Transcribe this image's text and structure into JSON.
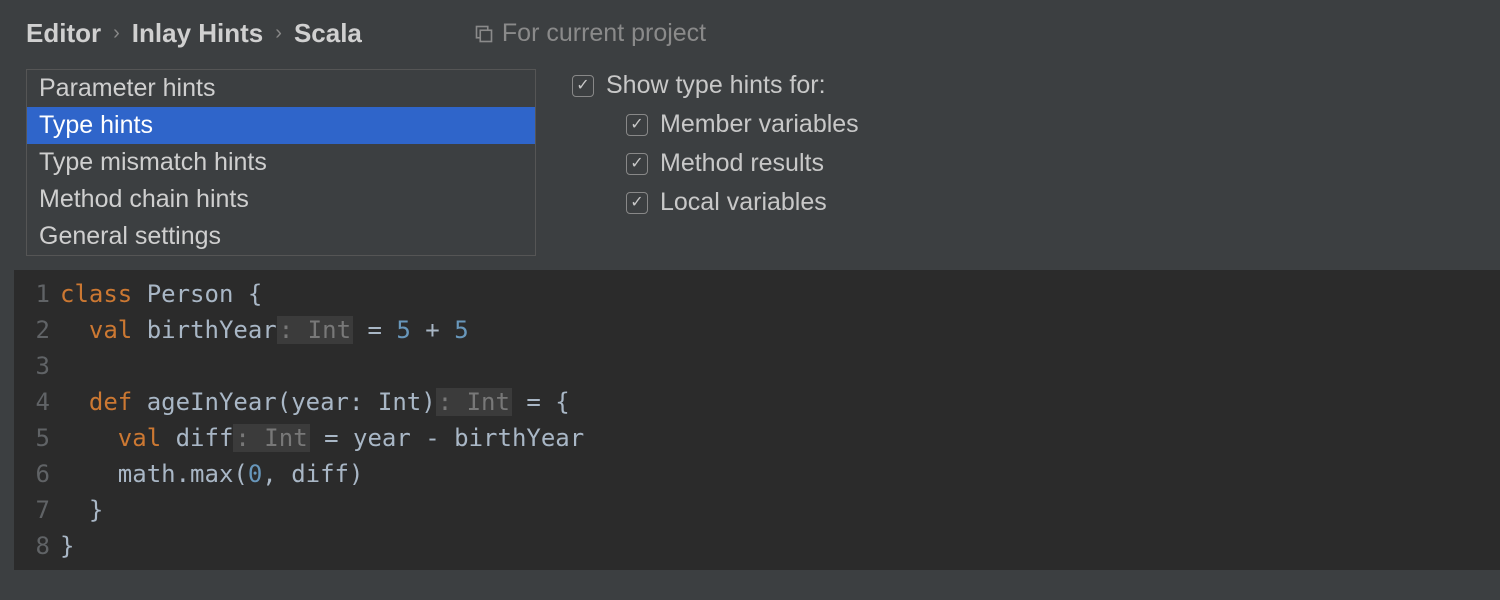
{
  "breadcrumb": {
    "items": [
      "Editor",
      "Inlay Hints",
      "Scala"
    ],
    "scope_label": "For current project"
  },
  "list": {
    "items": [
      "Parameter hints",
      "Type hints",
      "Type mismatch hints",
      "Method chain hints",
      "General settings"
    ],
    "selected_index": 1
  },
  "options": {
    "header": "Show type hints for:",
    "items": [
      "Member variables",
      "Method results",
      "Local variables"
    ]
  },
  "code": {
    "lines": [
      {
        "n": "1",
        "tokens": [
          [
            "kw",
            "class"
          ],
          [
            "id",
            " Person {"
          ]
        ]
      },
      {
        "n": "2",
        "tokens": [
          [
            "id",
            "  "
          ],
          [
            "kw",
            "val"
          ],
          [
            "id",
            " birthYear"
          ],
          [
            "hint",
            ": Int"
          ],
          [
            "id",
            " = "
          ],
          [
            "num",
            "5"
          ],
          [
            "id",
            " + "
          ],
          [
            "num",
            "5"
          ]
        ]
      },
      {
        "n": "3",
        "tokens": [
          [
            "id",
            ""
          ]
        ]
      },
      {
        "n": "4",
        "tokens": [
          [
            "id",
            "  "
          ],
          [
            "kw",
            "def"
          ],
          [
            "id",
            " ageInYear(year: Int)"
          ],
          [
            "hint",
            ": Int"
          ],
          [
            "id",
            " = {"
          ]
        ]
      },
      {
        "n": "5",
        "tokens": [
          [
            "id",
            "    "
          ],
          [
            "kw",
            "val"
          ],
          [
            "id",
            " diff"
          ],
          [
            "hint",
            ": Int"
          ],
          [
            "id",
            " = year - birthYear"
          ]
        ]
      },
      {
        "n": "6",
        "tokens": [
          [
            "id",
            "    math.max("
          ],
          [
            "num",
            "0"
          ],
          [
            "id",
            ", diff)"
          ]
        ]
      },
      {
        "n": "7",
        "tokens": [
          [
            "id",
            "  }"
          ]
        ]
      },
      {
        "n": "8",
        "tokens": [
          [
            "id",
            "}"
          ]
        ]
      }
    ]
  }
}
